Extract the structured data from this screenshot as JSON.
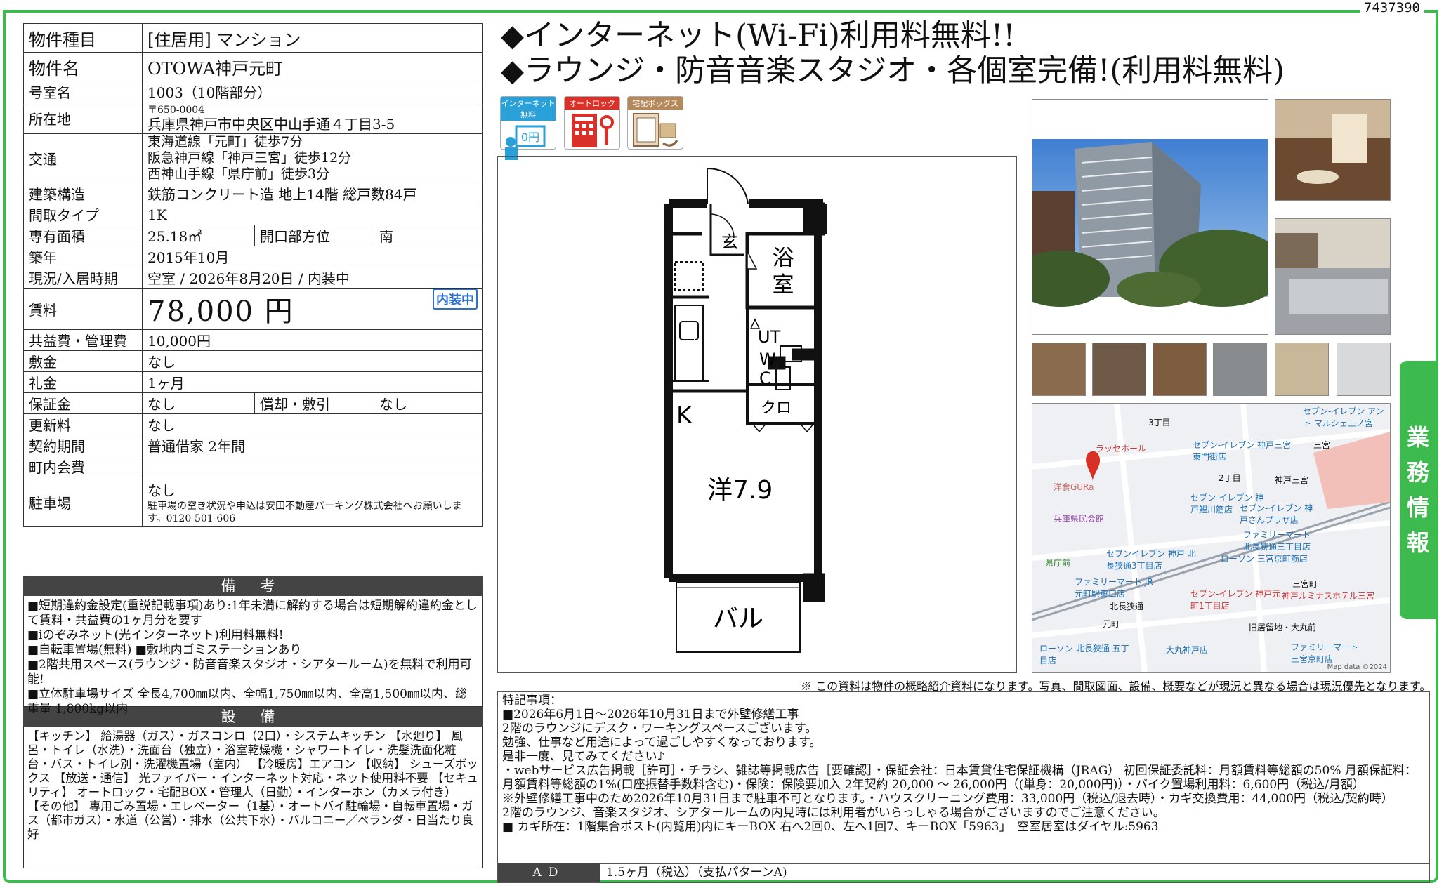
{
  "doc_id": "7437390",
  "headline": {
    "line1": "◆インターネット(Wi-Fi)利用料無料!!",
    "line2": "◆ラウンジ・防音音楽スタジオ・各個室完備!(利用料無料)"
  },
  "icons": [
    {
      "caption": "インターネット無料",
      "name": "internet-free-icon",
      "text": "0円"
    },
    {
      "caption": "オートロック",
      "name": "autolock-icon"
    },
    {
      "caption": "宅配ボックス",
      "name": "delivery-box-icon"
    }
  ],
  "spec": {
    "type_label": "物件種目",
    "type_value": "[住居用] マンション",
    "name_label": "物件名",
    "name_value": "OTOWA神戸元町",
    "room_label": "号室名",
    "room_value": "1003（10階部分）",
    "address_label": "所在地",
    "postal": "〒650-0004",
    "address": "兵庫県神戸市中央区中山手通４丁目3-5",
    "transit_label": "交通",
    "transit1": "東海道線「元町」徒歩7分",
    "transit2": "阪急神戸線「神戸三宮」徒歩12分",
    "transit3": "西神山手線「県庁前」徒歩3分",
    "structure_label": "建築構造",
    "structure_value": "鉄筋コンクリート造 地上14階 総戸数84戸",
    "layout_label": "間取タイプ",
    "layout_value": "1K",
    "area_label": "専有面積",
    "area_value": "25.18㎡",
    "orientation_label": "開口部方位",
    "orientation_value": "南",
    "built_label": "築年",
    "built_value": "2015年10月",
    "status_label": "現況/入居時期",
    "status_value": "空室 / 2026年8月20日 / 内装中",
    "rent_label": "賃料",
    "rent_value": "78,000 円",
    "rent_badge": "内装中",
    "fee_label": "共益費・管理費",
    "fee_value": "10,000円",
    "deposit_label": "敷金",
    "deposit_value": "なし",
    "keymoney_label": "礼金",
    "keymoney_value": "1ヶ月",
    "guarantee_label": "保証金",
    "guarantee_value": "なし",
    "amort_label": "償却・敷引",
    "amort_value": "なし",
    "renewal_label": "更新料",
    "renewal_value": "なし",
    "contract_label": "契約期間",
    "contract_value": "普通借家 2年間",
    "community_label": "町内会費",
    "community_value": "",
    "parking_label": "駐車場",
    "parking_value": "なし",
    "parking_note": "駐車場の空き状況や申込は安田不動産パーキング株式会社へお願いします。0120-501-606"
  },
  "remarks": {
    "title": "備 考",
    "lines": [
      "■短期違約金設定(重説記載事項)あり:1年未満に解約する場合は短期解約違約金として賃料・共益費の1ヶ月分を要す",
      "■iのぞみネット(光インターネット)利用料無料!",
      "■自転車置場(無料) ■敷地内ゴミステーションあり",
      "■2階共用スペース(ラウンジ・防音音楽スタジオ・シアタールーム)を無料で利用可能!",
      "■立体駐車場サイズ 全長4,700㎜以内、全幅1,750㎜以内、全高1,500㎜以内、総重量 1,800kg以内"
    ]
  },
  "equipment": {
    "title": "設 備",
    "text": "【キッチン】 給湯器（ガス）・ガスコンロ（2口）・システムキッチン 【水廻り】 風呂・トイレ（水洗）・洗面台（独立）・浴室乾燥機・シャワートイレ・洗髪洗面化粧台・バス・トイレ別・洗濯機置場（室内） 【冷暖房】エアコン 【収納】 シューズボックス 【放送・通信】 光ファイバー・インターネット対応・ネット使用料不要 【セキュリティ】 オートロック・宅配BOX・管理人（日勤）・インターホン（カメラ付き） 【その他】 専用ごみ置場・エレベーター（1基）・オートバイ駐輪場・自転車置場・ガス（都市ガス）・水道（公営）・排水（公共下水）・バルコニー／ベランダ・日当たり良好"
  },
  "floorplan": {
    "entrance": "玄",
    "bath": "浴室",
    "kitchen": "K",
    "ut": "UT",
    "wc": "W C",
    "closet": "クロ",
    "room": "洋7.9",
    "balcony": "バル"
  },
  "map": {
    "labels": [
      "3丁目",
      "ラッセホール",
      "セブン-イレブン 神戸三宮東門街店",
      "セブン-イレブン アント マルシェ三ノ宮",
      "三宮",
      "神戸三宮",
      "2丁目",
      "洋食GURa",
      "兵庫県民会館",
      "セブン-イレブン 神戸鯉川筋店",
      "セブン-イレブン 神戸さんプラザ店",
      "県庁前",
      "ファミリーマート 北長狭通三丁目店",
      "セブンイレブン 神戸 北長狭通3丁目店",
      "ファミリーマート JR元町駅東口店",
      "ローソン 三宮京町筋店",
      "三宮町",
      "北長狭通",
      "セブン-イレブン 神戸元町1丁目店",
      "神戸ルミナスホテル三宮",
      "元町",
      "旧居留地・大丸前",
      "ローソン 北長狭通 五丁目店",
      "大丸神戸店",
      "ファミリーマート 三宮京町店",
      "Map data ©2024"
    ]
  },
  "side_tab": "業務情報",
  "disclaimer": "※ この資料は物件の概略紹介資料になります。写真、間取図面、設備、概要などが現況と異なる場合は現況優先となります。",
  "special": {
    "title": "特記事項：",
    "lines": [
      "■2026年6月1日～2026年10月31日まで外壁修繕工事",
      "2階のラウンジにデスク・ワーキングスペースございます。",
      "勉強、仕事など用途によって過ごしやすくなっております。",
      "是非一度、見てみてください♪",
      "・webサービス広告掲載［許可］・チラシ、雑誌等掲載広告［要確認］・保証会社：日本賃貸住宅保証機構（JRAG） 初回保証委託料：月額賃料等総額の50% 月額保証料：月額賃料等総額の1%(口座振替手数料含む)・保険：保険要加入 2年契約 20,000 ～ 26,000円（(単身：20,000円)）・バイク置場利用料：6,600円（税込/月額）",
      "※外壁修繕工事中のため2026年10月31日まで駐車不可となります。・ハウスクリーニング費用：33,000円（税込/退去時）・カギ交換費用：44,000円（税込/契約時）",
      "2階のラウンジ、音楽スタジオ、シアタールームの内見時には利用者がいらっしゃる場合がございますのでご注意ください。",
      "■ カギ所在：1階集合ポスト(内覧用)内にキーBOX 右へ2回0、左へ1回7、キーBOX「5963」　空室居室はダイヤル:5963"
    ]
  },
  "ad": {
    "label": "AD",
    "value": "1.5ヶ月（税込）（支払パターンA)"
  },
  "colors": {
    "frame": "#3dba4e",
    "header_bg": "#444444",
    "badge": "#2e6fd0"
  }
}
